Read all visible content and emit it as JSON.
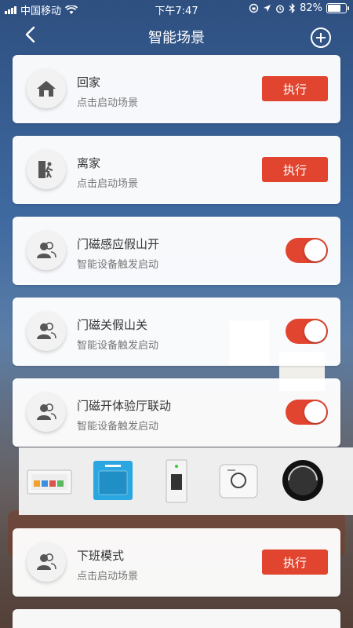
{
  "status_bar": {
    "carrier": "中国移动",
    "time": "下午7:47",
    "battery": "82%",
    "battery_level": 0.82
  },
  "nav": {
    "title": "智能场景",
    "back_icon": "chevron-left-icon",
    "add_icon": "plus-circle-icon"
  },
  "scenes": [
    {
      "name": "回家",
      "subtitle": "点击启动场景",
      "icon": "home-icon",
      "control": "button",
      "button_label": "执行"
    },
    {
      "name": "离家",
      "subtitle": "点击启动场景",
      "icon": "leave-home-icon",
      "control": "button",
      "button_label": "执行"
    },
    {
      "name": "门磁感应假山开",
      "subtitle": "智能设备触发启动",
      "icon": "users-icon",
      "control": "toggle",
      "enabled": true
    },
    {
      "name": "门磁关假山关",
      "subtitle": "智能设备触发启动",
      "icon": "users-icon",
      "control": "toggle",
      "enabled": true
    },
    {
      "name": "门磁开体验厅联动",
      "subtitle": "智能设备触发启动",
      "icon": "users-icon",
      "control": "toggle",
      "enabled": true
    },
    {
      "name": "下班模式",
      "subtitle": "点击启动场景",
      "icon": "users-icon",
      "control": "button",
      "button_label": "执行"
    }
  ],
  "colors": {
    "accent": "#e1452f",
    "card_bg": "#ffffff"
  }
}
